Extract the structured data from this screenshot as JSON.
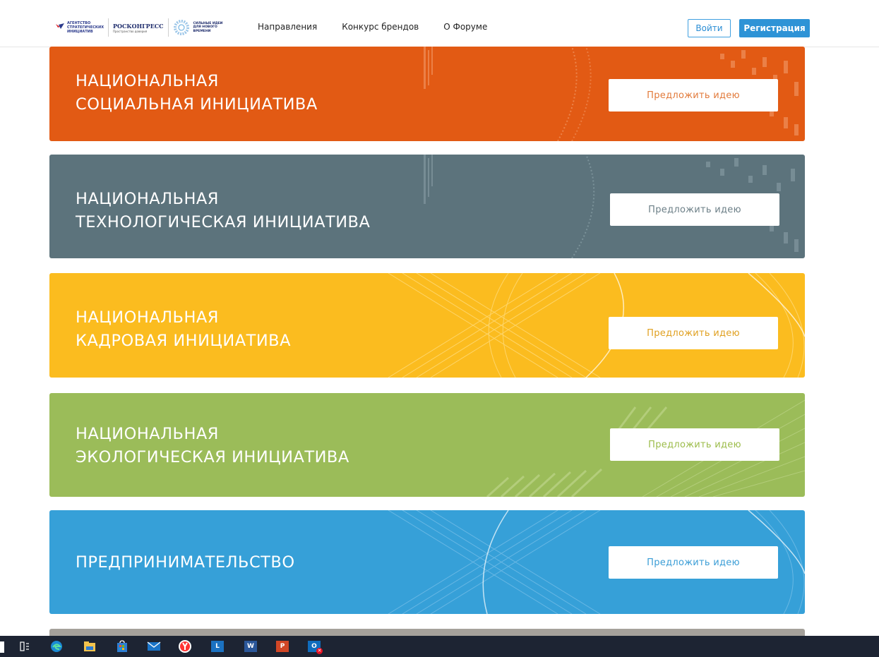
{
  "header": {
    "logos": {
      "asi": "АГЕНТСТВО СТРАТЕГИЧЕСКИХ ИНИЦИАТИВ",
      "roscongress": "РОСКОНГРЕСС",
      "roscongress_sub": "Пространство доверия",
      "strong_ideas": "СИЛЬНЫЕ ИДЕИ ДЛЯ НОВОГО ВРЕМЕНИ"
    },
    "nav": [
      "Направления",
      "Конкурс брендов",
      "О Форуме"
    ],
    "login_label": "Войти",
    "register_label": "Регистрация"
  },
  "banners": [
    {
      "line1": "НАЦИОНАЛЬНАЯ",
      "line2": "СОЦИАЛЬНАЯ ИНИЦИАТИВА",
      "button": "Предложить идею",
      "color": "#e25a14",
      "button_text_color": "#e27a3a"
    },
    {
      "line1": "НАЦИОНАЛЬНАЯ",
      "line2": "ТЕХНОЛОГИЧЕСКАЯ ИНИЦИАТИВА",
      "button": "Предложить идею",
      "color": "#5c737c",
      "button_text_color": "#6c7f87"
    },
    {
      "line1": "НАЦИОНАЛЬНАЯ",
      "line2": "КАДРОВАЯ ИНИЦИАТИВА",
      "button": "Предложить идею",
      "color": "#fbbc1f",
      "button_text_color": "#e0a020"
    },
    {
      "line1": "НАЦИОНАЛЬНАЯ",
      "line2": "ЭКОЛОГИЧЕСКАЯ ИНИЦИАТИВА",
      "button": "Предложить идею",
      "color": "#9bbc59",
      "button_text_color": "#9cbc4a"
    },
    {
      "line1": "ПРЕДПРИНИМАТЕЛЬСТВО",
      "line2": "",
      "button": "Предложить идею",
      "color": "#36a0d8",
      "button_text_color": "#3a9dd6"
    }
  ],
  "taskbar": {
    "icons": [
      "task-view-icon",
      "edge-icon",
      "file-explorer-icon",
      "store-icon",
      "mail-icon",
      "yandex-browser-icon",
      "lync-icon",
      "word-icon",
      "powerpoint-icon",
      "outlook-icon"
    ],
    "labels": {
      "lync": "L",
      "word": "W",
      "powerpoint": "P",
      "outlook": "O"
    }
  }
}
